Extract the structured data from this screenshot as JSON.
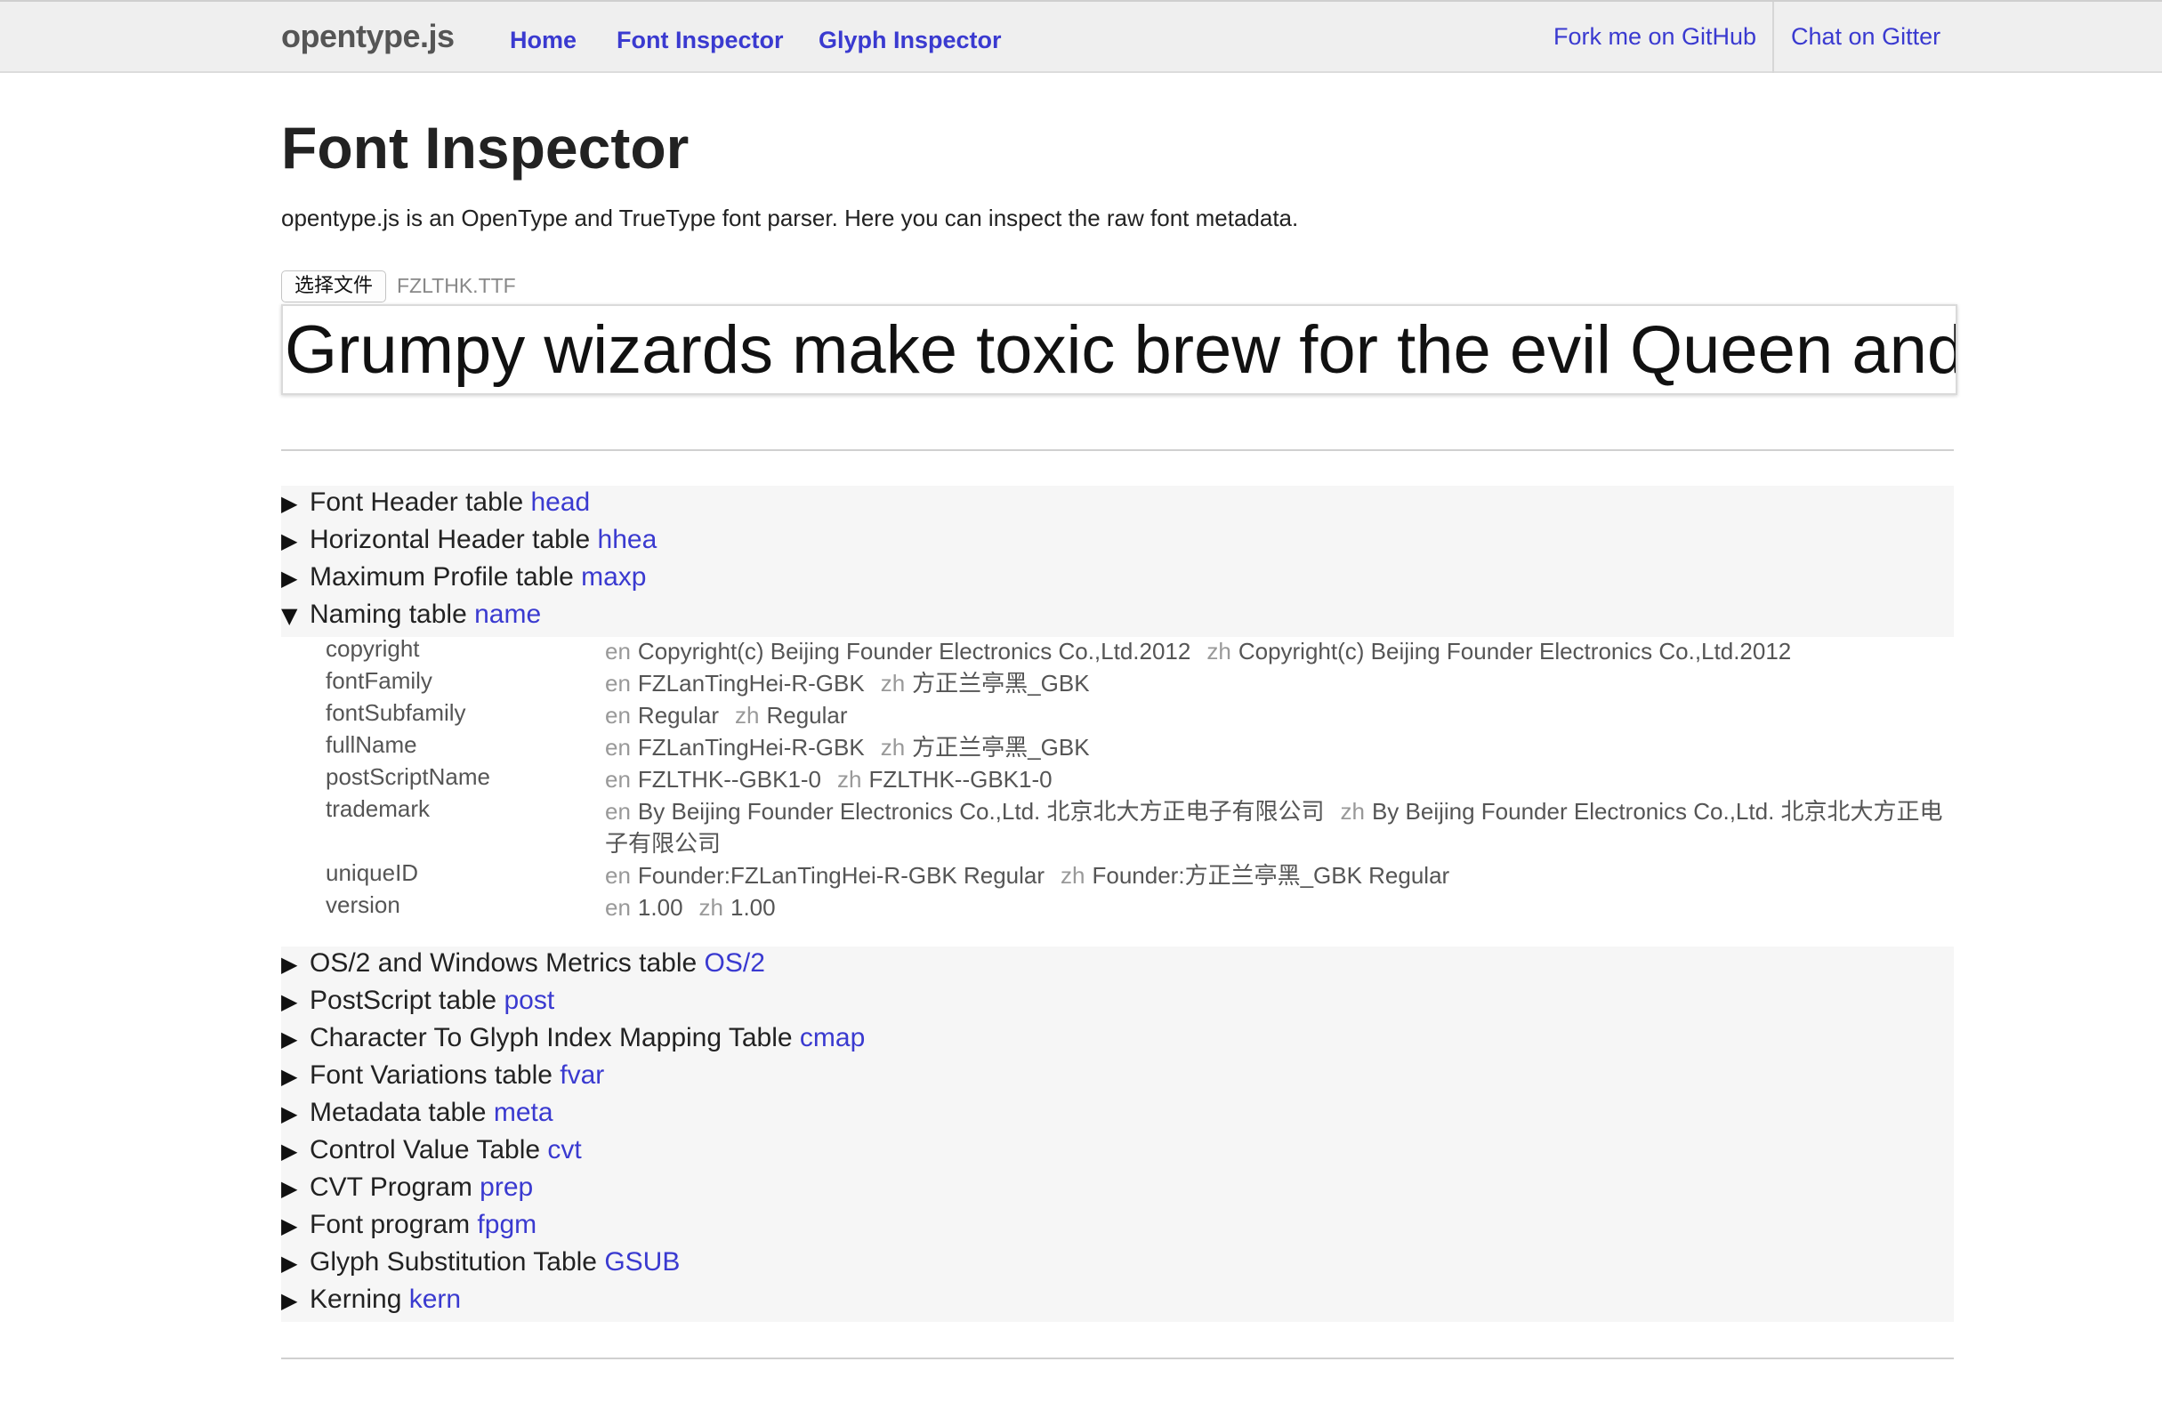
{
  "nav": {
    "brand": "opentype.js",
    "links": [
      "Home",
      "Font Inspector",
      "Glyph Inspector"
    ],
    "right_links": [
      "Fork me on GitHub",
      "Chat on Gitter"
    ]
  },
  "page": {
    "title": "Font Inspector",
    "intro": "opentype.js is an OpenType and TrueType font parser. Here you can inspect the raw font metadata."
  },
  "file": {
    "button_label": "选择文件",
    "file_name": "FZLTHK.TTF"
  },
  "preview": {
    "text": "Grumpy wizards make toxic brew for the evil Queen and Jack."
  },
  "tables_top": [
    {
      "label": "Font Header table",
      "tag": "head",
      "expanded": false
    },
    {
      "label": "Horizontal Header table",
      "tag": "hhea",
      "expanded": false
    },
    {
      "label": "Maximum Profile table",
      "tag": "maxp",
      "expanded": false
    },
    {
      "label": "Naming table",
      "tag": "name",
      "expanded": true
    }
  ],
  "name_entries": [
    {
      "key": "copyright",
      "en": "Copyright(c) Beijing Founder Electronics Co.,Ltd.2012",
      "zh": "Copyright(c) Beijing Founder Electronics Co.,Ltd.2012"
    },
    {
      "key": "fontFamily",
      "en": "FZLanTingHei-R-GBK",
      "zh": "方正兰亭黑_GBK"
    },
    {
      "key": "fontSubfamily",
      "en": "Regular",
      "zh": "Regular"
    },
    {
      "key": "fullName",
      "en": "FZLanTingHei-R-GBK",
      "zh": "方正兰亭黑_GBK"
    },
    {
      "key": "postScriptName",
      "en": "FZLTHK--GBK1-0",
      "zh": "FZLTHK--GBK1-0"
    },
    {
      "key": "trademark",
      "en": "By Beijing Founder Electronics Co.,Ltd. 北京北大方正电子有限公司",
      "zh": "By Beijing Founder Electronics Co.,Ltd. 北京北大方正电子有限公司"
    },
    {
      "key": "uniqueID",
      "en": "Founder:FZLanTingHei-R-GBK Regular",
      "zh": "Founder:方正兰亭黑_GBK Regular"
    },
    {
      "key": "version",
      "en": "1.00",
      "zh": "1.00"
    }
  ],
  "lang_labels": {
    "en": "en",
    "zh": "zh"
  },
  "tables_bottom": [
    {
      "label": "OS/2 and Windows Metrics table",
      "tag": "OS/2",
      "expanded": false
    },
    {
      "label": "PostScript table",
      "tag": "post",
      "expanded": false
    },
    {
      "label": "Character To Glyph Index Mapping Table",
      "tag": "cmap",
      "expanded": false
    },
    {
      "label": "Font Variations table",
      "tag": "fvar",
      "expanded": false
    },
    {
      "label": "Metadata table",
      "tag": "meta",
      "expanded": false
    },
    {
      "label": "Control Value Table",
      "tag": "cvt",
      "expanded": false
    },
    {
      "label": "CVT Program",
      "tag": "prep",
      "expanded": false
    },
    {
      "label": "Font program",
      "tag": "fpgm",
      "expanded": false
    },
    {
      "label": "Glyph Substitution Table",
      "tag": "GSUB",
      "expanded": false
    },
    {
      "label": "Kerning",
      "tag": "kern",
      "expanded": false
    }
  ],
  "glyphs": {
    "collapsed": "▶",
    "expanded": "▼"
  },
  "colors": {
    "link": "#3a3ad0",
    "navbar_bg": "#efefef",
    "section_bg": "#f6f6f6"
  }
}
